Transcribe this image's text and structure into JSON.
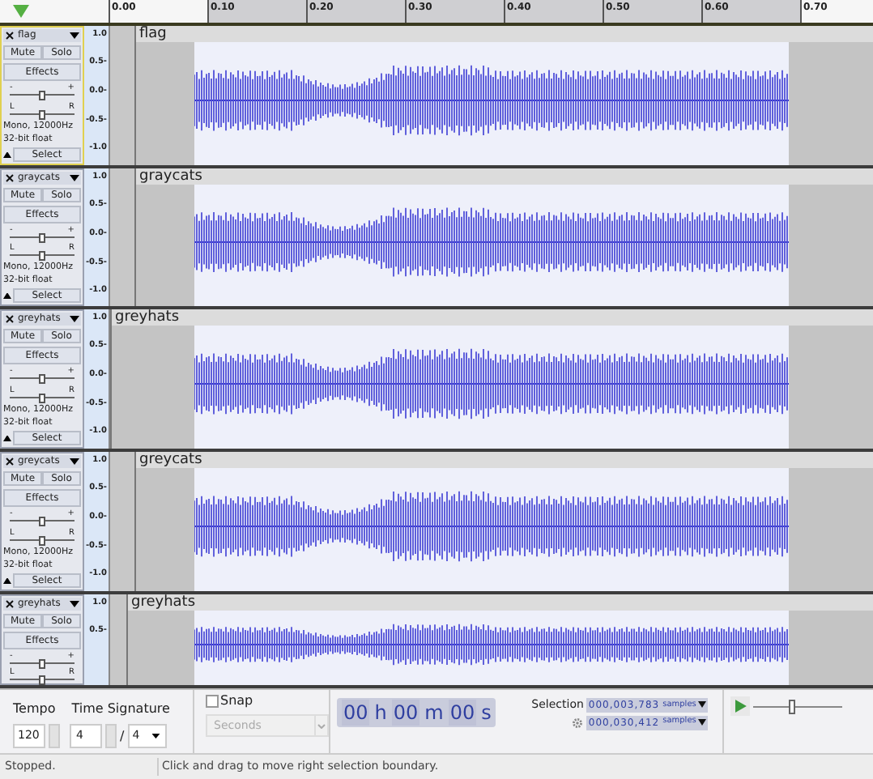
{
  "ruler": {
    "ticks": [
      "0.00",
      "0.10",
      "0.20",
      "0.30",
      "0.40",
      "0.50",
      "0.60",
      "0.70"
    ]
  },
  "tracks": [
    {
      "name": "flag",
      "focused": true,
      "mute": "Mute",
      "solo": "Solo",
      "effects": "Effects",
      "gain_minus": "-",
      "gain_plus": "+",
      "pan_left": "L",
      "pan_right": "R",
      "format": "Mono, 12000Hz",
      "bit_depth": "32-bit float",
      "select": "Select",
      "scale": [
        "1.0",
        "0.5-",
        "0.0-",
        "-0.5-",
        "-1.0"
      ],
      "clip_name": "flag"
    },
    {
      "name": "graycats",
      "focused": false,
      "mute": "Mute",
      "solo": "Solo",
      "effects": "Effects",
      "gain_minus": "-",
      "gain_plus": "+",
      "pan_left": "L",
      "pan_right": "R",
      "format": "Mono, 12000Hz",
      "bit_depth": "32-bit float",
      "select": "Select",
      "scale": [
        "1.0",
        "0.5-",
        "0.0-",
        "-0.5-",
        "-1.0"
      ],
      "clip_name": "graycats"
    },
    {
      "name": "greyhats",
      "focused": false,
      "mute": "Mute",
      "solo": "Solo",
      "effects": "Effects",
      "gain_minus": "-",
      "gain_plus": "+",
      "pan_left": "L",
      "pan_right": "R",
      "format": "Mono, 12000Hz",
      "bit_depth": "32-bit float",
      "select": "Select",
      "scale": [
        "1.0",
        "0.5-",
        "0.0-",
        "-0.5-",
        "-1.0"
      ],
      "clip_name": "greyhats"
    },
    {
      "name": "greycats",
      "focused": false,
      "mute": "Mute",
      "solo": "Solo",
      "effects": "Effects",
      "gain_minus": "-",
      "gain_plus": "+",
      "pan_left": "L",
      "pan_right": "R",
      "format": "Mono, 12000Hz",
      "bit_depth": "32-bit float",
      "select": "Select",
      "scale": [
        "1.0",
        "0.5-",
        "0.0-",
        "-0.5-",
        "-1.0"
      ],
      "clip_name": "greycats"
    },
    {
      "name": "greyhats",
      "focused": false,
      "mute": "Mute",
      "solo": "Solo",
      "effects": "Effects",
      "gain_minus": "-",
      "gain_plus": "+",
      "pan_left": "L",
      "pan_right": "R",
      "scale": [
        "1.0",
        "0.5-"
      ],
      "clip_name": "greyhats"
    }
  ],
  "toolbar": {
    "tempo_label": "Tempo",
    "tempo": "120",
    "time_signature_label": "Time Signature",
    "numerator": "4",
    "slash": "/",
    "denominator": "4",
    "snap": {
      "label": "Snap",
      "checked": false
    },
    "snap_unit": {
      "value": "Seconds",
      "disabled": true
    },
    "time": [
      {
        "digits": "00",
        "unit": "h"
      },
      {
        "digits": "00",
        "unit": "m"
      },
      {
        "digits": "00",
        "unit": "s"
      }
    ],
    "selection_label": "Selection",
    "selection": [
      {
        "value": "000,003,783",
        "unit": "samples"
      },
      {
        "value": "000,030,412",
        "unit": "samples"
      }
    ],
    "play_speed": {
      "level": 0.42
    }
  },
  "status_bar": {
    "state": "Stopped.",
    "hint": "Click and drag to move right selection boundary."
  }
}
